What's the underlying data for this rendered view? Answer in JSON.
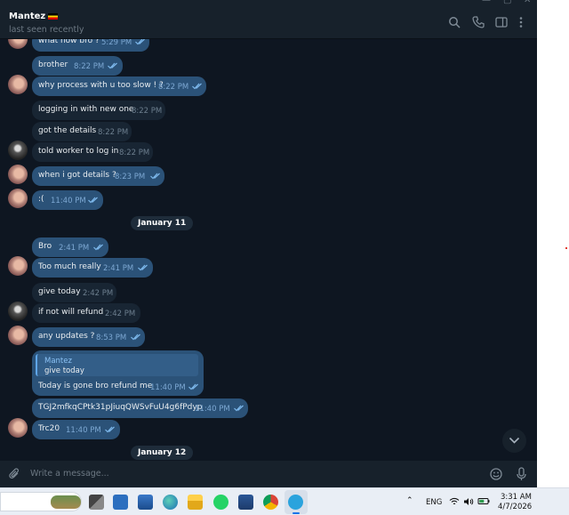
{
  "header": {
    "contact_name": "Mantez",
    "status": "last seen recently"
  },
  "messages": [
    {
      "text": "what now bro ?",
      "time": "5:29 PM"
    },
    {
      "text": "brother",
      "time": "8:22 PM"
    },
    {
      "text": "why process with u too slow ! ?",
      "time": "8:22 PM"
    },
    {
      "text": "logging in with new one",
      "time": "8:22 PM"
    },
    {
      "text": "got the details",
      "time": "8:22 PM"
    },
    {
      "text": "told worker to log in",
      "time": "8:22 PM"
    },
    {
      "text": "when i got details ?",
      "time": "8:23 PM"
    },
    {
      "text": ":(",
      "time": "11:40 PM"
    },
    {
      "text": "Bro",
      "time": "2:41 PM"
    },
    {
      "text": "Too much really",
      "time": "2:41 PM"
    },
    {
      "text": "give today",
      "time": "2:42 PM"
    },
    {
      "text": "if not will refund",
      "time": "2:42 PM"
    },
    {
      "text": "any updates ?",
      "time": "8:53 PM"
    },
    {
      "reply_to_name": "Mantez",
      "reply_to_text": "give today",
      "text": "Today is gone bro refund me",
      "time": "11:40 PM"
    },
    {
      "text": "TGJ2mfkqCPtk31pJiuqQWSvFuU4g6fPdyp",
      "time": "11:40 PM"
    },
    {
      "text": "Trc20",
      "time": "11:40 PM"
    }
  ],
  "dates": [
    "January 11",
    "January 12"
  ],
  "composer": {
    "placeholder": "Write a message..."
  },
  "taskbar": {
    "language": "ENG",
    "time": "3:31 AM",
    "date": "4/7/2026"
  },
  "colors": {
    "chat_bg": "#0e1621",
    "outgoing_bubble": "#2b5278",
    "incoming_bubble": "#182533",
    "accent": "#5fa6e8"
  }
}
